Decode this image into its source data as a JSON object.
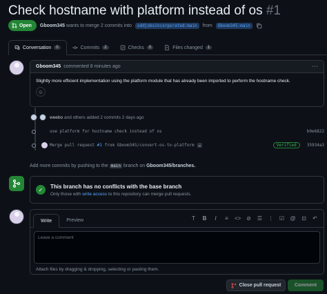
{
  "header": {
    "title": "Check hostname with platform instead of os",
    "number": "#1",
    "state": "Open",
    "author": "Gboom345",
    "action_text": "wants to merge 2 commits into",
    "base_branch": "oddjobsincorporated:main",
    "from_text": "from",
    "head_branch": "Gboom345:main"
  },
  "tabs": [
    {
      "label": "Conversation",
      "count": "0"
    },
    {
      "label": "Commits",
      "count": "2"
    },
    {
      "label": "Checks",
      "count": "0"
    },
    {
      "label": "Files changed",
      "count": "1"
    }
  ],
  "comment": {
    "author": "Gboom345",
    "meta": "commented 8 minutes ago",
    "body": "Slightly more efficient implementation using the platform module that has already been imported to perform the hostname check."
  },
  "timeline": {
    "actor": "weebo",
    "summary": "and others added 2 commits 2 days ago",
    "commits": [
      {
        "message": "use platform for hostname check instead of os",
        "sha": "b0e6822",
        "verified": ""
      },
      {
        "message_prefix": "Merge pull request",
        "pr": "#1",
        "message_suffix": "from Gboom345/convert-os-to-platform",
        "ellipsis": "…",
        "verified": "Verified",
        "sha": "35934a3"
      }
    ]
  },
  "hint": {
    "prefix": "Add more commits by pushing to the",
    "branch": "main",
    "middle": "branch on",
    "repo": "Gboom345/branches."
  },
  "merge": {
    "title": "This branch has no conflicts with the base branch",
    "desc_prefix": "Only those with",
    "desc_link": "write access",
    "desc_suffix": "to this repository can merge pull requests."
  },
  "editor": {
    "tab_write": "Write",
    "tab_preview": "Preview",
    "placeholder": "Leave a comment",
    "attach": "Attach files by dragging & dropping, selecting or pasting them.",
    "toolbar_icons": [
      "heading-icon",
      "bold-icon",
      "italic-icon",
      "quote-icon",
      "code-icon",
      "link-icon",
      "unordered-list-icon",
      "ordered-list-icon",
      "task-list-icon",
      "mention-icon",
      "reference-icon",
      "reply-icon"
    ]
  },
  "buttons": {
    "close": "Close pull request",
    "comment": "Comment"
  },
  "colors": {
    "background": "#0d1117",
    "accent_green": "#238636",
    "link_blue": "#58a6ff",
    "border": "#30363d"
  }
}
